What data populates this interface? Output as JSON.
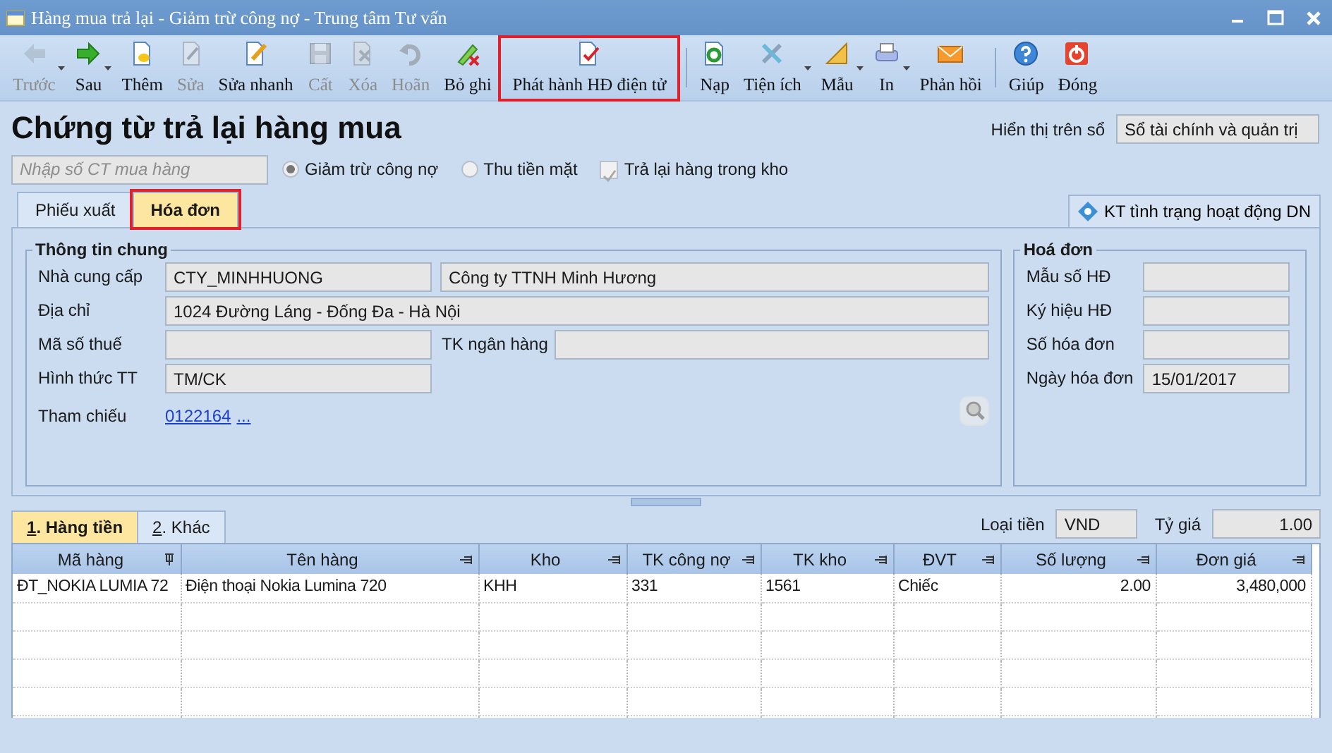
{
  "window": {
    "title": "Hàng mua trả lại - Giảm trừ công nợ - Trung tâm Tư vấn"
  },
  "toolbar": [
    {
      "kind": "button",
      "label": "Trước",
      "disabled": true,
      "dropdown": true,
      "highlighted": false
    },
    {
      "kind": "button",
      "label": "Sau",
      "disabled": false,
      "dropdown": true,
      "highlighted": false
    },
    {
      "kind": "button",
      "label": "Thêm",
      "disabled": false,
      "dropdown": false,
      "highlighted": false
    },
    {
      "kind": "button",
      "label": "Sửa",
      "disabled": true,
      "dropdown": false,
      "highlighted": false
    },
    {
      "kind": "button",
      "label": "Sửa nhanh",
      "disabled": false,
      "dropdown": false,
      "highlighted": false
    },
    {
      "kind": "button",
      "label": "Cất",
      "disabled": true,
      "dropdown": false,
      "highlighted": false
    },
    {
      "kind": "button",
      "label": "Xóa",
      "disabled": true,
      "dropdown": false,
      "highlighted": false
    },
    {
      "kind": "button",
      "label": "Hoãn",
      "disabled": true,
      "dropdown": false,
      "highlighted": false
    },
    {
      "kind": "button",
      "label": "Bỏ ghi",
      "disabled": false,
      "dropdown": false,
      "highlighted": false
    },
    {
      "kind": "button",
      "label": "Phát hành HĐ điện tử",
      "disabled": false,
      "dropdown": false,
      "highlighted": true
    },
    {
      "kind": "separator"
    },
    {
      "kind": "button",
      "label": "Nạp",
      "disabled": false,
      "dropdown": false,
      "highlighted": false
    },
    {
      "kind": "button",
      "label": "Tiện ích",
      "disabled": false,
      "dropdown": true,
      "highlighted": false
    },
    {
      "kind": "button",
      "label": "Mẫu",
      "disabled": false,
      "dropdown": true,
      "highlighted": false
    },
    {
      "kind": "button",
      "label": "In",
      "disabled": false,
      "dropdown": true,
      "highlighted": false
    },
    {
      "kind": "button",
      "label": "Phản hồi",
      "disabled": false,
      "dropdown": false,
      "highlighted": false
    },
    {
      "kind": "separator"
    },
    {
      "kind": "button",
      "label": "Giúp",
      "disabled": false,
      "dropdown": false,
      "highlighted": false
    },
    {
      "kind": "button",
      "label": "Đóng",
      "disabled": false,
      "dropdown": false,
      "highlighted": false
    }
  ],
  "heading": "Chứng từ trả lại hàng mua",
  "book": {
    "label": "Hiển thị trên sổ",
    "value": "Sổ tài chính và quản trị"
  },
  "voucher_search": {
    "placeholder": "Nhập số CT mua hàng"
  },
  "options": [
    {
      "kind": "radio",
      "label": "Giảm trừ công nợ",
      "checked": true
    },
    {
      "kind": "radio",
      "label": "Thu tiền mặt",
      "checked": false
    },
    {
      "kind": "checkbox",
      "label": "Trả lại hàng trong kho",
      "checked": true
    }
  ],
  "tabs": [
    {
      "label": "Phiếu xuất",
      "selected": false,
      "highlighted": false
    },
    {
      "label": "Hóa đơn",
      "selected": true,
      "highlighted": true
    }
  ],
  "check_button": {
    "label": "KT tình trạng hoạt động DN"
  },
  "general": {
    "title": "Thông tin chung",
    "supplier": {
      "label": "Nhà cung cấp",
      "code": "CTY_MINHHUONG",
      "name": "Công ty TTNH Minh Hương"
    },
    "address": {
      "label": "Địa chỉ",
      "value": "1024 Đường Láng - Đống Đa - Hà Nội"
    },
    "tax_code": {
      "label": "Mã số thuế"
    },
    "bank_account": {
      "label": "TK ngân hàng"
    },
    "payment_method": {
      "label": "Hình thức TT",
      "value": "TM/CK"
    },
    "reference": {
      "label": "Tham chiếu",
      "link": "0122164",
      "more": "..."
    }
  },
  "invoice": {
    "title": "Hoá đơn",
    "fields": [
      {
        "label": "Mẫu số HĐ"
      },
      {
        "label": "Ký hiệu HĐ"
      },
      {
        "label": "Số hóa đơn"
      },
      {
        "label": "Ngày hóa đơn",
        "value": "15/01/2017"
      }
    ]
  },
  "detail_tabs": [
    {
      "mnemonic": "1",
      "label": ". Hàng tiền",
      "selected": true
    },
    {
      "mnemonic": "2",
      "label": ". Khác",
      "selected": false
    }
  ],
  "currency": {
    "label": "Loại tiền",
    "value": "VND"
  },
  "rate": {
    "label": "Tỷ giá",
    "value": "1.00"
  },
  "table": {
    "columns": [
      {
        "label": "Mã hàng",
        "kind": "text",
        "pinned": true
      },
      {
        "label": "Tên hàng",
        "kind": "text",
        "pinned": false
      },
      {
        "label": "Kho",
        "kind": "text",
        "pinned": false
      },
      {
        "label": "TK công nợ",
        "kind": "text",
        "pinned": false
      },
      {
        "label": "TK kho",
        "kind": "text",
        "pinned": false
      },
      {
        "label": "ĐVT",
        "kind": "text",
        "pinned": false
      },
      {
        "label": "Số lượng",
        "kind": "number",
        "pinned": false
      },
      {
        "label": "Đơn giá",
        "kind": "number",
        "pinned": false
      }
    ],
    "rows": [
      [
        "ĐT_NOKIA LUMIA 72",
        "Điện thoại Nokia Lumina 720",
        "KHH",
        "331",
        "1561",
        "Chiếc",
        "2.00",
        "3,480,000"
      ]
    ]
  }
}
